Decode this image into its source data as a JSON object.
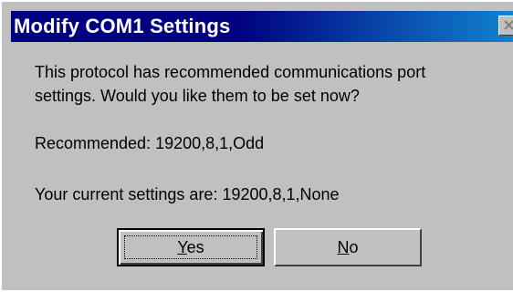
{
  "window": {
    "title": "Modify COM1 Settings",
    "close_icon": "close-icon"
  },
  "message": {
    "line1": "This protocol has recommended communications port",
    "line2": "settings. Would you like them to be set now?"
  },
  "recommended": "Recommended: 19200,8,1,Odd",
  "current": "Your current settings are: 19200,8,1,None",
  "buttons": {
    "yes": {
      "mnemonic": "Y",
      "rest": "es"
    },
    "no": {
      "mnemonic": "N",
      "rest": "o"
    }
  },
  "colors": {
    "face": "#c0c0c0",
    "titlebar": "#000080"
  }
}
